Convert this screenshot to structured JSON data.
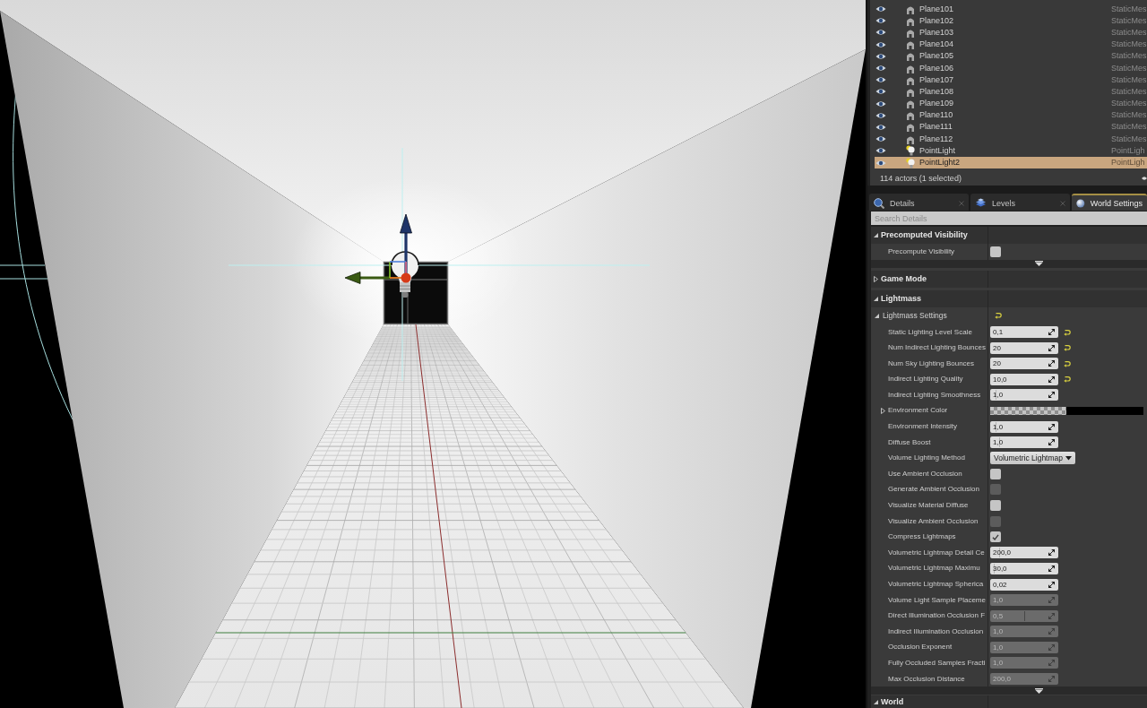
{
  "outliner": {
    "rows": [
      {
        "name": "Plane101",
        "type": "StaticMes",
        "kind": "mesh",
        "visible": true,
        "selected": false
      },
      {
        "name": "Plane102",
        "type": "StaticMes",
        "kind": "mesh",
        "visible": true,
        "selected": false
      },
      {
        "name": "Plane103",
        "type": "StaticMes",
        "kind": "mesh",
        "visible": true,
        "selected": false
      },
      {
        "name": "Plane104",
        "type": "StaticMes",
        "kind": "mesh",
        "visible": true,
        "selected": false
      },
      {
        "name": "Plane105",
        "type": "StaticMes",
        "kind": "mesh",
        "visible": true,
        "selected": false
      },
      {
        "name": "Plane106",
        "type": "StaticMes",
        "kind": "mesh",
        "visible": true,
        "selected": false
      },
      {
        "name": "Plane107",
        "type": "StaticMes",
        "kind": "mesh",
        "visible": true,
        "selected": false
      },
      {
        "name": "Plane108",
        "type": "StaticMes",
        "kind": "mesh",
        "visible": true,
        "selected": false
      },
      {
        "name": "Plane109",
        "type": "StaticMes",
        "kind": "mesh",
        "visible": true,
        "selected": false
      },
      {
        "name": "Plane110",
        "type": "StaticMes",
        "kind": "mesh",
        "visible": true,
        "selected": false
      },
      {
        "name": "Plane111",
        "type": "StaticMes",
        "kind": "mesh",
        "visible": true,
        "selected": false
      },
      {
        "name": "Plane112",
        "type": "StaticMes",
        "kind": "mesh",
        "visible": true,
        "selected": false
      },
      {
        "name": "PointLight",
        "type": "PointLigh",
        "kind": "light",
        "visible": true,
        "selected": false
      },
      {
        "name": "PointLight2",
        "type": "PointLigh",
        "kind": "light",
        "visible": true,
        "selected": true
      }
    ],
    "summary": "114 actors (1 selected)"
  },
  "tabs": [
    {
      "label": "Details",
      "kind": "details",
      "selected": false
    },
    {
      "label": "Levels",
      "kind": "levels",
      "selected": false
    },
    {
      "label": "World Settings",
      "kind": "world",
      "selected": true
    }
  ],
  "search": {
    "placeholder": "Search Details"
  },
  "categories": [
    {
      "title": "Precomputed Visibility",
      "expanded": true,
      "advanced_expanded": false,
      "items": [
        {
          "kind": "checkbox",
          "label": "Precompute Visibility",
          "checked": false,
          "disabled": false,
          "modified": false
        }
      ]
    },
    {
      "title": "Game Mode",
      "expanded": false
    },
    {
      "title": "Lightmass",
      "expanded": true,
      "advanced_expanded": false,
      "groups": [
        {
          "title": "Lightmass Settings",
          "expanded": true,
          "modified": true,
          "items": [
            {
              "kind": "number",
              "label": "Static Lighting Level Scale",
              "value": "0,1",
              "disabled": false,
              "modified": true
            },
            {
              "kind": "number",
              "label": "Num Indirect Lighting Bounces",
              "value": "20",
              "disabled": false,
              "modified": true
            },
            {
              "kind": "number",
              "label": "Num Sky Lighting Bounces",
              "value": "20",
              "disabled": false,
              "modified": true
            },
            {
              "kind": "number",
              "label": "Indirect Lighting Quality",
              "value": "10,0",
              "disabled": false,
              "modified": true
            },
            {
              "kind": "number",
              "label": "Indirect Lighting Smoothness",
              "value": "1,0",
              "disabled": false,
              "modified": false,
              "level": 0.08
            },
            {
              "kind": "color",
              "label": "Environment Color",
              "color": "#000000",
              "expanded": false,
              "modified": false
            },
            {
              "kind": "number",
              "label": "Environment Intensity",
              "value": "1,0",
              "disabled": false,
              "modified": false,
              "level": 0.08
            },
            {
              "kind": "number",
              "label": "Diffuse Boost",
              "value": "1,0",
              "disabled": false,
              "modified": false,
              "level": 0.13
            },
            {
              "kind": "dropdown",
              "label": "Volume Lighting Method",
              "value": "Volumetric Lightmap",
              "modified": false
            },
            {
              "kind": "checkbox",
              "label": "Use Ambient Occlusion",
              "checked": false,
              "disabled": false,
              "modified": false
            },
            {
              "kind": "checkbox",
              "label": "Generate Ambient Occlusion",
              "checked": false,
              "disabled": true,
              "modified": false
            },
            {
              "kind": "checkbox",
              "label": "Visualize Material Diffuse",
              "checked": false,
              "disabled": false,
              "modified": false
            },
            {
              "kind": "checkbox",
              "label": "Visualize Ambient Occlusion",
              "checked": false,
              "disabled": true,
              "modified": false
            },
            {
              "kind": "checkbox",
              "label": "Compress Lightmaps",
              "checked": true,
              "disabled": false,
              "modified": false
            },
            {
              "kind": "number",
              "label": "Volumetric Lightmap Detail Ce",
              "value": "200,0",
              "disabled": false,
              "modified": false,
              "level": 0.13
            },
            {
              "kind": "number",
              "label": "Volumetric Lightmap Maximu",
              "value": "30,0",
              "disabled": false,
              "modified": false,
              "level": 0.05
            },
            {
              "kind": "number",
              "label": "Volumetric Lightmap Spherica",
              "value": "0,02",
              "disabled": false,
              "modified": false
            },
            {
              "kind": "number",
              "label": "Volume Light Sample Placeme",
              "value": "1,0",
              "disabled": true,
              "modified": false
            },
            {
              "kind": "number",
              "label": "Direct Illumination Occlusion F",
              "value": "0,5",
              "disabled": true,
              "modified": false,
              "level": 0.5
            },
            {
              "kind": "number",
              "label": "Indirect Illumination Occlusion",
              "value": "1,0",
              "disabled": true,
              "modified": false
            },
            {
              "kind": "number",
              "label": "Occlusion Exponent",
              "value": "1,0",
              "disabled": true,
              "modified": false
            },
            {
              "kind": "number",
              "label": "Fully Occluded Samples Fracti",
              "value": "1,0",
              "disabled": true,
              "modified": false
            },
            {
              "kind": "number",
              "label": "Max Occlusion Distance",
              "value": "200,0",
              "disabled": true,
              "modified": false
            }
          ]
        }
      ]
    },
    {
      "title": "World",
      "expanded": true
    }
  ]
}
